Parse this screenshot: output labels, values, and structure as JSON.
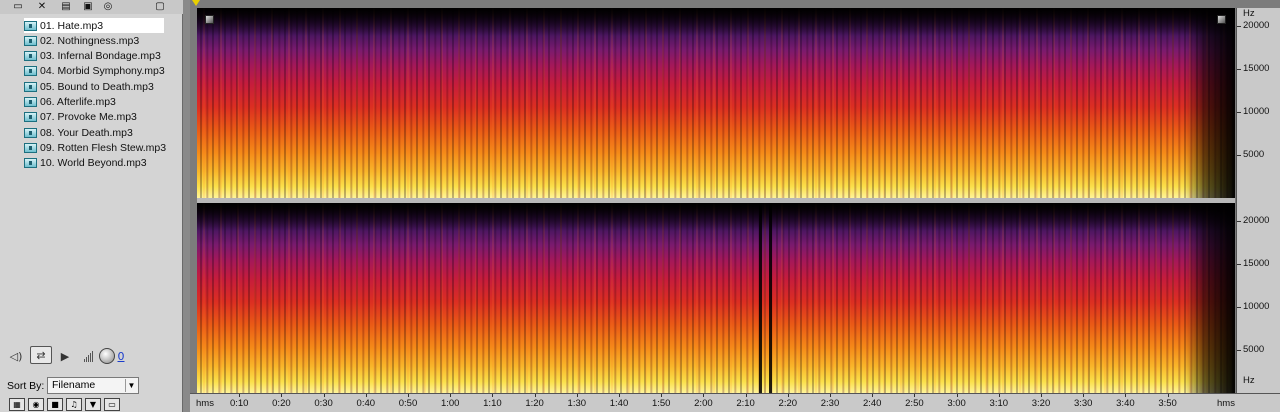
{
  "toolbar": {
    "icons": [
      "open-folder-icon",
      "close-file-icon",
      "batch-icon",
      "cd-extract-icon",
      "record-icon",
      "autoplay-icon"
    ]
  },
  "files": [
    {
      "label": "01. Hate.mp3",
      "selected": true
    },
    {
      "label": "02. Nothingness.mp3",
      "selected": false
    },
    {
      "label": "03. Infernal Bondage.mp3",
      "selected": false
    },
    {
      "label": "04. Morbid Symphony.mp3",
      "selected": false
    },
    {
      "label": "05. Bound to Death.mp3",
      "selected": false
    },
    {
      "label": "06. Afterlife.mp3",
      "selected": false
    },
    {
      "label": "07. Provoke Me.mp3",
      "selected": false
    },
    {
      "label": "08. Your Death.mp3",
      "selected": false
    },
    {
      "label": "09. Rotten Flesh Stew.mp3",
      "selected": false
    },
    {
      "label": "10. World Beyond.mp3",
      "selected": false
    }
  ],
  "transport": {
    "volume_value": "0",
    "icons": [
      "speaker-icon",
      "loop-icon",
      "play-icon",
      "volume-knob-icon"
    ]
  },
  "sort": {
    "label": "Sort By:",
    "value": "Filename"
  },
  "bottom_toolbar": {
    "icons": [
      "view-icon",
      "info-icon",
      "stop-icon",
      "insert-icon",
      "filter-icon",
      "media-icon"
    ]
  },
  "frequency_ruler": {
    "unit": "Hz",
    "ticks": [
      "20000",
      "15000",
      "10000",
      "5000"
    ]
  },
  "time_ruler": {
    "unit": "hms",
    "labels": [
      "0:10",
      "0:20",
      "0:30",
      "0:40",
      "0:50",
      "1:00",
      "1:10",
      "1:20",
      "1:30",
      "1:40",
      "1:50",
      "2:00",
      "2:10",
      "2:20",
      "2:30",
      "2:40",
      "2:50",
      "3:00",
      "3:10",
      "3:20",
      "3:30",
      "3:40",
      "3:50"
    ]
  },
  "colors": {
    "spectrum_low": "#fff49a",
    "spectrum_mid": "#dc2e22",
    "spectrum_high": "#4a1660",
    "cursor": "#e8d000"
  }
}
